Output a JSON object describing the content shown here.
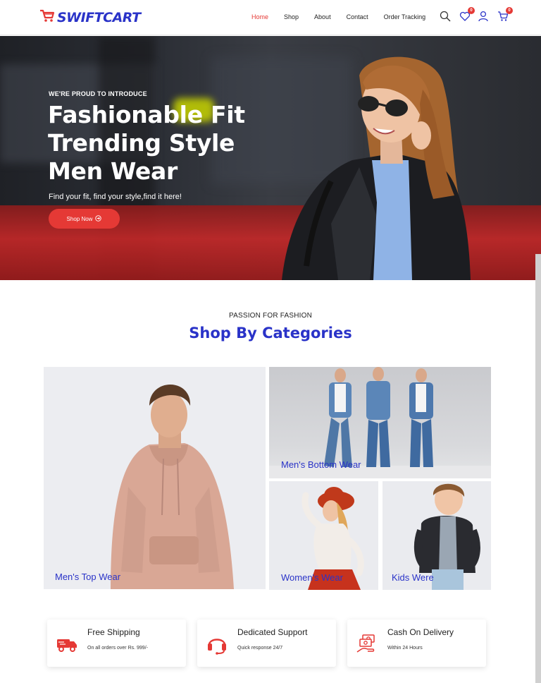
{
  "brand": {
    "name": "SWIFTCART",
    "accent": "#2a33c8",
    "red": "#e53935"
  },
  "nav": [
    {
      "label": "Home",
      "active": true
    },
    {
      "label": "Shop",
      "active": false
    },
    {
      "label": "About",
      "active": false
    },
    {
      "label": "Contact",
      "active": false
    },
    {
      "label": "Order Tracking",
      "active": false
    }
  ],
  "header_icons": {
    "search": "search-icon",
    "wishlist": {
      "icon": "heart-icon",
      "count": "0"
    },
    "account": "user-icon",
    "cart": {
      "icon": "cart-icon",
      "count": "0"
    }
  },
  "hero": {
    "eyebrow": "WE'RE PROUD TO INTRODUCE",
    "title_lines": [
      "Fashionable Fit",
      "Trending Style",
      "Men Wear"
    ],
    "subtitle": "Find your fit, find your style,find it here!",
    "button": "Shop Now"
  },
  "categories": {
    "eyebrow": "PASSION FOR FASHION",
    "title": "Shop By Categories",
    "tiles": [
      {
        "label": "Men's Top Wear"
      },
      {
        "label": "Men's Bottom Wear"
      },
      {
        "label": "Women's Wear"
      },
      {
        "label": "Kids Were"
      }
    ]
  },
  "features": [
    {
      "title": "Free Shipping",
      "subtitle": "On all orders over Rs. 999/-",
      "icon": "truck-icon"
    },
    {
      "title": "Dedicated Support",
      "subtitle": "Quick response 24/7",
      "icon": "headset-icon"
    },
    {
      "title": "Cash On Delivery",
      "subtitle": "Within 24 Hours",
      "icon": "cash-hand-icon"
    }
  ]
}
